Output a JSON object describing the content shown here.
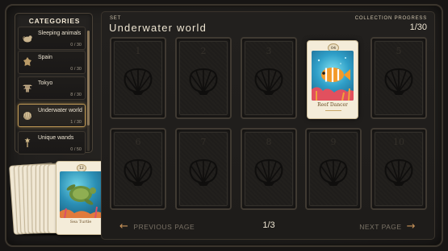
{
  "sidebar": {
    "title": "CATEGORIES",
    "items": [
      {
        "label": "Sleeping animals",
        "count": "0 / 30",
        "icon": "sleeping-animal-icon",
        "active": false
      },
      {
        "label": "Spain",
        "count": "0 / 30",
        "icon": "spain-emblem-icon",
        "active": false
      },
      {
        "label": "Tokyo",
        "count": "8 / 30",
        "icon": "tokyo-pagoda-icon",
        "active": false
      },
      {
        "label": "Underwater world",
        "count": "1 / 30",
        "icon": "shell-icon",
        "active": true
      },
      {
        "label": "Unique wands",
        "count": "0 / 50",
        "icon": "wand-icon",
        "active": false
      }
    ]
  },
  "preview_stack": {
    "number": "12",
    "name": "Sea Turtle",
    "icon": "sea-turtle-card-art"
  },
  "header": {
    "set_label": "SET",
    "set_title": "Underwater world",
    "progress_label": "COLLECTION PROGRESS",
    "progress_value": "1/30"
  },
  "slots": [
    {
      "number": "1",
      "owned": false
    },
    {
      "number": "2",
      "owned": false
    },
    {
      "number": "3",
      "owned": false
    },
    {
      "number": "04",
      "owned": true,
      "name": "Reef Dancer",
      "icon": "clownfish-card-art"
    },
    {
      "number": "5",
      "owned": false
    },
    {
      "number": "6",
      "owned": false
    },
    {
      "number": "7",
      "owned": false
    },
    {
      "number": "8",
      "owned": false
    },
    {
      "number": "9",
      "owned": false
    },
    {
      "number": "10",
      "owned": false
    }
  ],
  "pagination": {
    "prev_label": "PREVIOUS PAGE",
    "next_label": "NEXT PAGE",
    "page": "1/3"
  },
  "colors": {
    "accent": "#c8935a",
    "active_border": "#c19a55",
    "background": "#211f1d",
    "card_paper": "#f4ecd9"
  }
}
